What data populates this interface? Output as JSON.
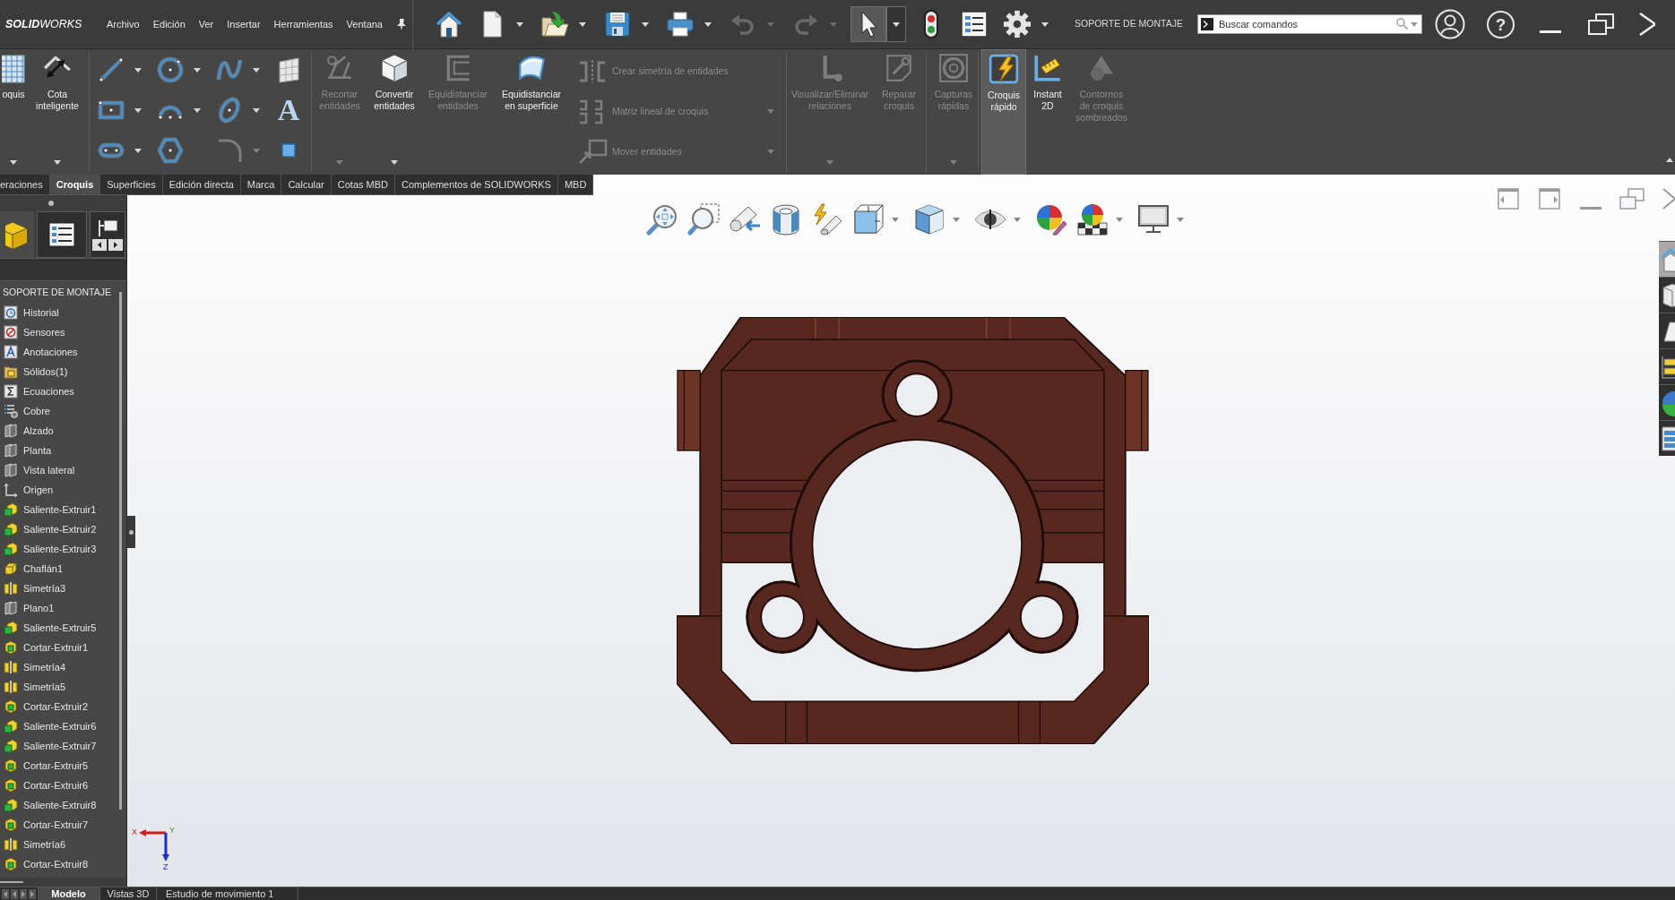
{
  "title_bar": {
    "logo": "**SOLID**WORKS",
    "menu": [
      "Archivo",
      "Edición",
      "Ver",
      "Insertar",
      "Herramientas",
      "Ventana"
    ],
    "toolbar": [
      {
        "dropdown": false,
        "disabled": false,
        "on": false
      },
      {
        "dropdown": true,
        "disabled": false,
        "on": false
      },
      {
        "dropdown": true,
        "disabled": false,
        "on": false
      },
      {
        "dropdown": true,
        "disabled": false,
        "on": false
      },
      {
        "dropdown": true,
        "disabled": false,
        "on": false
      },
      {
        "dropdown": true,
        "disabled": true,
        "on": false
      },
      {
        "dropdown": true,
        "disabled": true,
        "on": false
      },
      {
        "dropdown": true,
        "disabled": false,
        "on": true
      },
      {
        "dropdown": false,
        "disabled": false,
        "on": false
      },
      {
        "dropdown": false,
        "disabled": false,
        "on": false
      },
      {
        "dropdown": true,
        "disabled": false,
        "on": false
      }
    ],
    "document_title": "SOPORTE DE MONTAJE",
    "search": {
      "placeholder": "Buscar comandos"
    },
    "help": "?"
  },
  "ribbon": {
    "groups": [
      {
        "buttons": [
          {
            "label": "oquis",
            "disabled": false,
            "dropdown": true,
            "on": false
          },
          {
            "label": "Cota\ninteligente",
            "disabled": false,
            "dropdown": true,
            "on": false
          }
        ]
      },
      {
        "tools": [
          {
            "disabled": false,
            "dropdown": true
          },
          {
            "disabled": false,
            "dropdown": true
          },
          {
            "disabled": false,
            "dropdown": true
          },
          {
            "disabled": false,
            "dropdown": false
          },
          {
            "disabled": false,
            "dropdown": true
          },
          {
            "disabled": false,
            "dropdown": true
          },
          {
            "disabled": false,
            "dropdown": true
          },
          {
            "disabled": false,
            "dropdown": false,
            "glyph": "A"
          },
          {
            "disabled": false,
            "dropdown": true
          },
          {
            "disabled": false,
            "dropdown": false
          },
          {
            "disabled": true,
            "dropdown": true
          },
          {
            "disabled": false,
            "dropdown": false
          }
        ]
      },
      {
        "buttons": [
          {
            "label": "Recortar\nentidades",
            "disabled": true,
            "dropdown": true,
            "on": false
          },
          {
            "label": "Convertir\nentidades",
            "disabled": false,
            "dropdown": true,
            "on": false
          },
          {
            "label": "Equidistanciar\nentidades",
            "disabled": true,
            "dropdown": false,
            "on": false
          },
          {
            "label": "Equidistanciar\nen superficie",
            "disabled": false,
            "dropdown": false,
            "on": false
          }
        ],
        "rows": [
          {
            "label": "Crear simetría de entidades",
            "disabled": true,
            "dropdown": false
          },
          {
            "label": "Matriz lineal de croquis",
            "disabled": true,
            "dropdown": true
          },
          {
            "label": "Mover entidades",
            "disabled": true,
            "dropdown": true
          }
        ]
      },
      {
        "buttons": [
          {
            "label": "Visualizar/Eliminar\nrelaciones",
            "disabled": true,
            "dropdown": true,
            "on": false
          },
          {
            "label": "Reparar\ncroquis",
            "disabled": true,
            "dropdown": false,
            "on": false
          }
        ]
      },
      {
        "buttons": [
          {
            "label": "Capturas\nrápidas",
            "disabled": true,
            "dropdown": true,
            "on": false
          }
        ]
      },
      {
        "buttons": [
          {
            "label": "Croquis\nrápido",
            "disabled": false,
            "dropdown": false,
            "on": true
          },
          {
            "label": "Instant\n2D",
            "disabled": false,
            "dropdown": false,
            "on": false
          },
          {
            "label": "Contornos\nde croquis\nsombreados",
            "disabled": true,
            "dropdown": false,
            "on": false
          }
        ]
      }
    ]
  },
  "tabs": [
    {
      "label": "eraciones",
      "selected": false
    },
    {
      "label": "Croquis",
      "selected": true
    },
    {
      "label": "Superficies",
      "selected": false
    },
    {
      "label": "Edición directa",
      "selected": false
    },
    {
      "label": "Marca",
      "selected": false
    },
    {
      "label": "Calcular",
      "selected": false
    },
    {
      "label": "Cotas MBD",
      "selected": false
    },
    {
      "label": "Complementos de SOLIDWORKS",
      "selected": false
    },
    {
      "label": "MBD",
      "selected": false
    }
  ],
  "feature_manager": {
    "panel_tabs": [
      {
        "selected": true
      },
      {
        "selected": false
      },
      {
        "selected": false
      }
    ],
    "root": "SOPORTE DE MONTAJE",
    "items": [
      {
        "label": "Historial",
        "kind": "history"
      },
      {
        "label": "Sensores",
        "kind": "sensors"
      },
      {
        "label": "Anotaciones",
        "kind": "annotations"
      },
      {
        "label": "Sólidos(1)",
        "kind": "solids"
      },
      {
        "label": "Ecuaciones",
        "kind": "equations"
      },
      {
        "label": "Cobre",
        "kind": "material"
      },
      {
        "label": "Alzado",
        "kind": "plane"
      },
      {
        "label": "Planta",
        "kind": "plane"
      },
      {
        "label": "Vista lateral",
        "kind": "plane"
      },
      {
        "label": "Origen",
        "kind": "origin"
      },
      {
        "label": "Saliente-Extruir1",
        "kind": "boss"
      },
      {
        "label": "Saliente-Extruir2",
        "kind": "boss"
      },
      {
        "label": "Saliente-Extruir3",
        "kind": "boss"
      },
      {
        "label": "Chaflán1",
        "kind": "chamfer"
      },
      {
        "label": "Simetría3",
        "kind": "mirror"
      },
      {
        "label": "Plano1",
        "kind": "plane"
      },
      {
        "label": "Saliente-Extruir5",
        "kind": "boss"
      },
      {
        "label": "Cortar-Extruir1",
        "kind": "cut"
      },
      {
        "label": "Simetría4",
        "kind": "mirror"
      },
      {
        "label": "Simetría5",
        "kind": "mirror"
      },
      {
        "label": "Cortar-Extruir2",
        "kind": "cut"
      },
      {
        "label": "Saliente-Extruir6",
        "kind": "boss"
      },
      {
        "label": "Saliente-Extruir7",
        "kind": "boss"
      },
      {
        "label": "Cortar-Extruir5",
        "kind": "cut"
      },
      {
        "label": "Cortar-Extruir6",
        "kind": "cut"
      },
      {
        "label": "Saliente-Extruir8",
        "kind": "boss"
      },
      {
        "label": "Cortar-Extruir7",
        "kind": "cut"
      },
      {
        "label": "Simetría6",
        "kind": "mirror"
      },
      {
        "label": "Cortar-Extruir8",
        "kind": "cut"
      }
    ]
  },
  "view_toolbar": [
    {
      "dropdown": false
    },
    {
      "dropdown": false
    },
    {
      "dropdown": false
    },
    {
      "dropdown": false
    },
    {
      "dropdown": false
    },
    {
      "dropdown": true
    },
    {
      "dropdown": true
    },
    {
      "dropdown": true
    },
    {
      "dropdown": false
    },
    {
      "dropdown": true
    },
    {
      "dropdown": true
    }
  ],
  "task_pane_tabs": [
    {
      "selected": true
    },
    {
      "selected": false
    },
    {
      "selected": false
    },
    {
      "selected": false
    },
    {
      "selected": false
    },
    {
      "selected": false
    }
  ],
  "triad": {
    "x": "X",
    "y": "Y",
    "z": "Z"
  },
  "bottom_tabs": [
    {
      "label": "Modelo",
      "selected": true
    },
    {
      "label": "Vistas 3D",
      "selected": false
    },
    {
      "label": "Estudio de movimiento 1",
      "selected": false
    }
  ]
}
